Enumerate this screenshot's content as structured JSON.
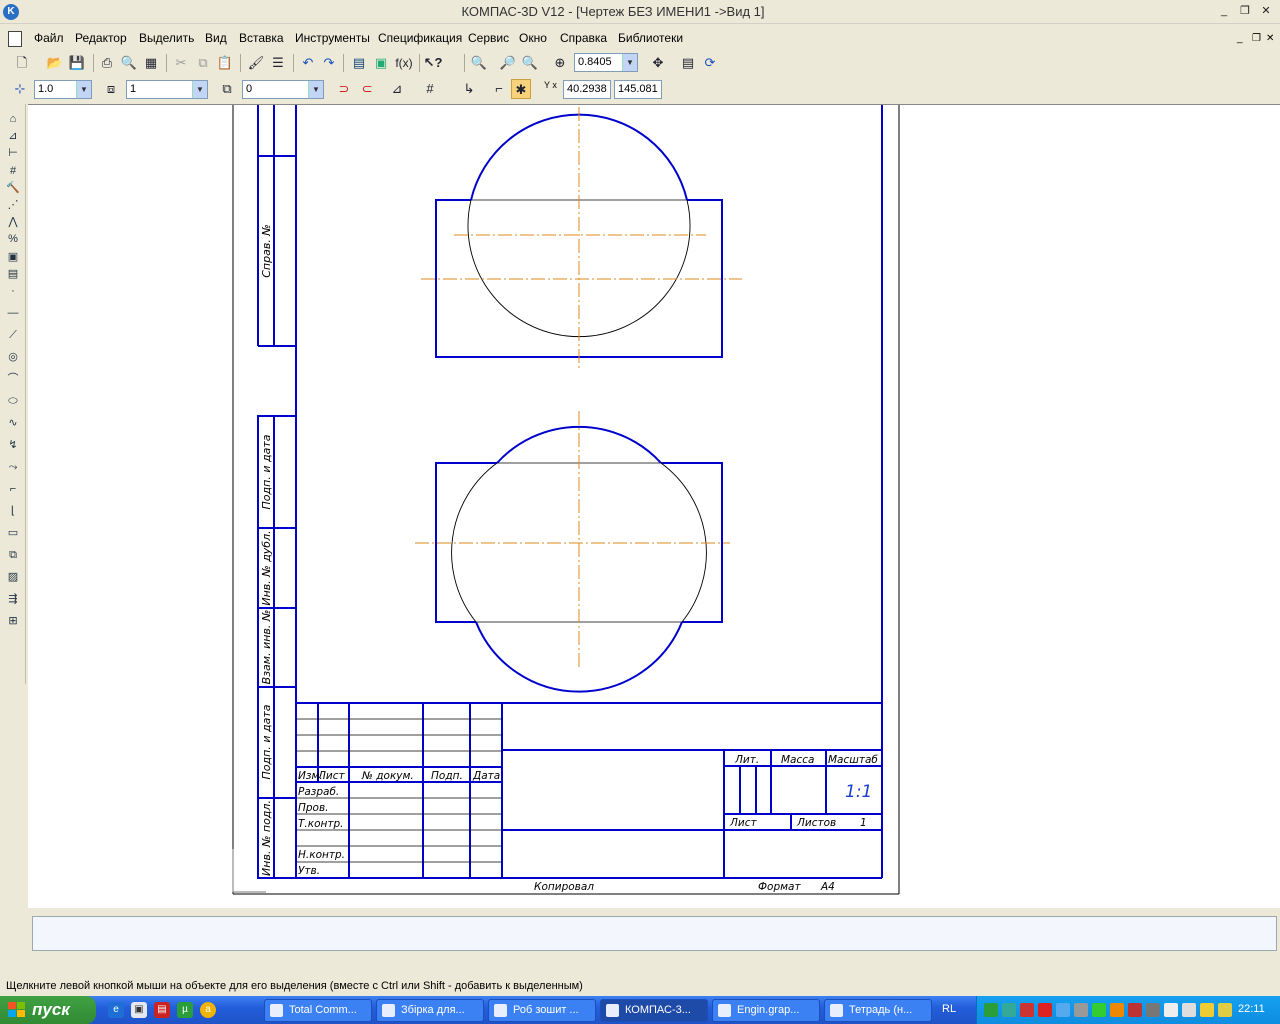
{
  "window": {
    "title": "КОМПАС-3D V12 - [Чертеж БЕЗ ИМЕНИ1 ->Вид 1]",
    "app_icon": "kompas-logo-icon",
    "controls": [
      "minimize-icon",
      "restore-icon",
      "close-icon"
    ],
    "control_glyphs": [
      "_",
      "❐",
      "✕"
    ]
  },
  "menu": {
    "items": [
      "Файл",
      "Редактор",
      "Выделить",
      "Вид",
      "Вставка",
      "Инструменты",
      "Спецификация",
      "Сервис",
      "Окно",
      "Справка",
      "Библиотеки"
    ],
    "doc_controls": [
      "_",
      "❐",
      "✕"
    ]
  },
  "toolbar_standard": {
    "zoom_value": "0.8405",
    "icons": [
      "new-document-icon",
      "open-icon",
      "save-icon",
      "print-icon",
      "print-preview-icon",
      "cut-icon",
      "copy-icon",
      "paste-icon",
      "properties-icon",
      "undo-icon",
      "redo-icon",
      "manager-icon",
      "variables-icon",
      "fx-icon",
      "help-icon",
      "zoom-window-icon",
      "zoom-icon",
      "zoom-in-icon",
      "pan-icon",
      "refresh-icon"
    ]
  },
  "toolbar_current_state": {
    "step_value": "1.0",
    "layer_value": "1",
    "style_value": "0",
    "coord_x": "40.2938",
    "coord_y": "145.081",
    "coord_label": "Y x"
  },
  "left_toolbar": {
    "icons": [
      "geometry-icon",
      "dimensions-icon",
      "symbols-icon",
      "editing-icon",
      "parametrization-icon",
      "measure-icon",
      "select-icon",
      "associative-views-icon",
      "spec-icon",
      "reports-icon",
      "point-icon",
      "auxiliary-line-icon",
      "segment-icon",
      "circle-icon",
      "arc-icon",
      "ellipse-icon",
      "spline-icon",
      "polyline-icon",
      "nurbs-icon",
      "fillet-icon",
      "chamfer-icon",
      "rectangle-icon",
      "contour-icon",
      "hatch-icon",
      "equidistant-icon",
      "insert-fragment-icon"
    ]
  },
  "drawing": {
    "side_stamp_labels": [
      "Справ. №",
      "Подп. и дата",
      "Инв. № дубл.",
      "Взам. инв. №",
      "Подп. и дата",
      "Инв. № подл."
    ],
    "title_block": {
      "header": [
        "Изм.",
        "Лист",
        "№ докум.",
        "Подп.",
        "Дата"
      ],
      "rows": [
        "Разраб.",
        "Пров.",
        "Т.контр.",
        "Н.контр.",
        "Утв."
      ],
      "lit": "Лит.",
      "mass": "Масса",
      "scale": "Масштаб",
      "scale_value": "1:1",
      "sheet": "Лист",
      "sheets": "Листов",
      "sheets_value": "1"
    },
    "copied_label": "Копировал",
    "format_label": "Формат",
    "format_value": "А4"
  },
  "status_bar": {
    "message": "Щелкните левой кнопкой мыши на объекте для его выделения (вместе с Ctrl или Shift - добавить к выделенным)"
  },
  "taskbar": {
    "start_label": "пуск",
    "tasks": [
      "Total Comm...",
      "Збірка для...",
      "Роб зошит ...",
      "КОМПАС-3...",
      "Engin.grap...",
      "Тетрадь (н..."
    ],
    "active_task_index": 3,
    "language": "RL",
    "clock": "22:11"
  },
  "colors": {
    "frame_blue": "#0000cc",
    "axis_orange": "#e08a1e",
    "taskbar_blue": "#245edb"
  }
}
